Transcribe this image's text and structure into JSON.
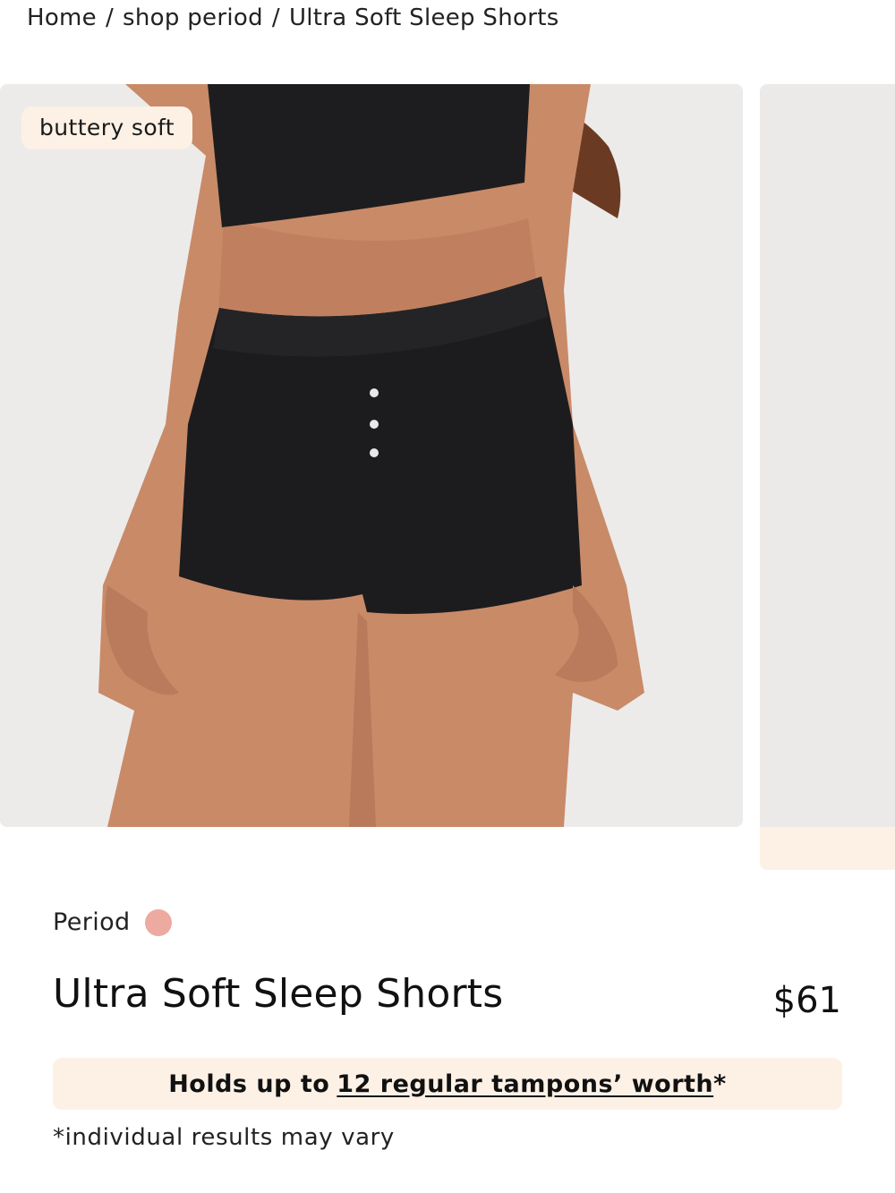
{
  "breadcrumb": {
    "items": [
      "Home",
      "shop period"
    ],
    "separator": "/",
    "current": "Ultra Soft Sleep Shorts"
  },
  "gallery": {
    "badge": "buttery soft",
    "image_subject": "model wearing black ultra soft sleep shorts"
  },
  "product": {
    "category": "Period",
    "category_color": "#ecaaa0",
    "title": "Ultra Soft Sleep Shorts",
    "price": "$61"
  },
  "absorbency": {
    "prefix": "Holds up to",
    "link_text": "12 regular tampons’ worth",
    "suffix": "*"
  },
  "disclaimer": "*individual results may vary",
  "colors": {
    "accent_bg": "#fdf1e6",
    "text": "#111111",
    "dot": "#ecaaa0"
  }
}
